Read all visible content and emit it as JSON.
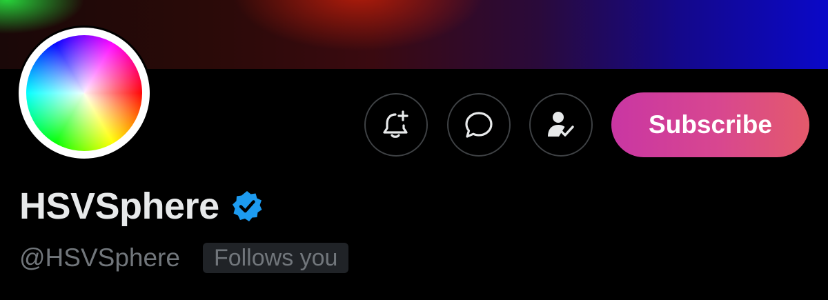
{
  "banner": {
    "gradient_colors": [
      "#28dc3c",
      "#be1e0a",
      "#3a0a10",
      "#0a08c8"
    ]
  },
  "avatar": {
    "description_icon": "color-wheel-icon",
    "ring_color": "#ffffff"
  },
  "actions": {
    "notify": {
      "icon": "bell-plus-icon"
    },
    "message": {
      "icon": "chat-bubble-icon"
    },
    "following": {
      "icon": "person-check-icon"
    },
    "subscribe_label": "Subscribe",
    "subscribe_colors": [
      "#c936a3",
      "#e45a6b"
    ]
  },
  "profile": {
    "display_name": "HSVSphere",
    "verified_icon": "verified-badge-icon",
    "verified_color": "#1d9bf0",
    "handle": "@HSVSphere",
    "follows_you_label": "Follows you"
  }
}
